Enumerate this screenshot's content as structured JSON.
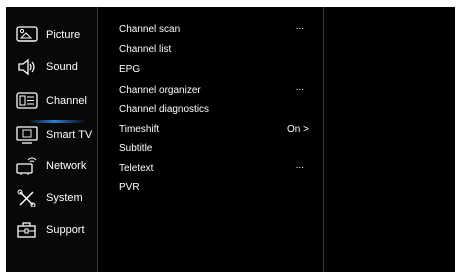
{
  "sidebar": {
    "items": [
      {
        "label": "Picture",
        "icon": "picture-icon"
      },
      {
        "label": "Sound",
        "icon": "speaker-icon"
      },
      {
        "label": "Channel",
        "icon": "channel-icon",
        "active": true
      },
      {
        "label": "Smart TV",
        "icon": "tv-icon"
      },
      {
        "label": "Network",
        "icon": "network-icon"
      },
      {
        "label": "System",
        "icon": "tools-icon"
      },
      {
        "label": "Support",
        "icon": "toolbox-icon"
      }
    ]
  },
  "channel_menu": {
    "items": [
      {
        "label": "Channel scan",
        "value": "..."
      },
      {
        "label": "Channel list",
        "value": ""
      },
      {
        "label": "EPG",
        "value": ""
      },
      {
        "label": "Channel organizer",
        "value": "..."
      },
      {
        "label": "Channel diagnostics",
        "value": ""
      },
      {
        "label": "Timeshift",
        "value": "On >"
      },
      {
        "label": "Subtitle",
        "value": ""
      },
      {
        "label": "Teletext",
        "value": "..."
      },
      {
        "label": "PVR",
        "value": ""
      }
    ]
  },
  "colors": {
    "background": "#000000",
    "accent": "#2d7fd8",
    "text": "#ffffff"
  }
}
